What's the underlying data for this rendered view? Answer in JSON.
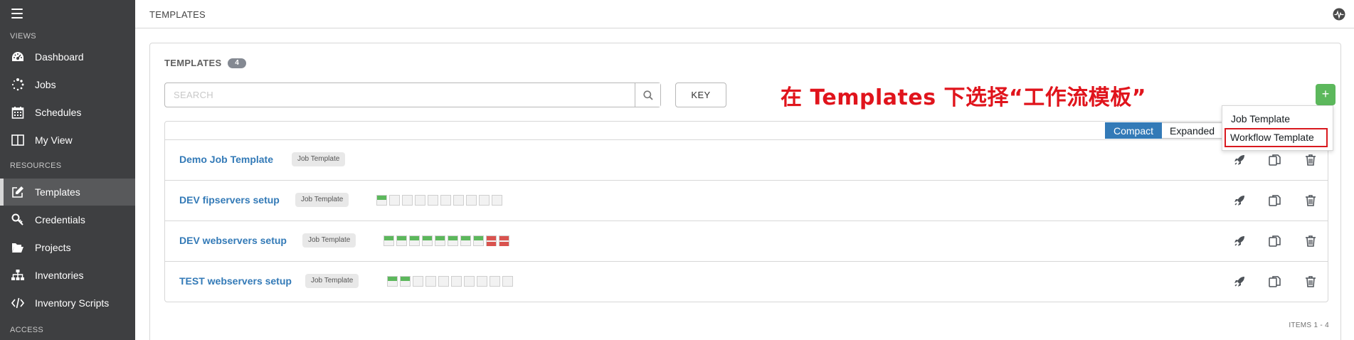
{
  "sidebar": {
    "sections": {
      "views": "VIEWS",
      "resources": "RESOURCES",
      "access": "ACCESS"
    },
    "items": [
      {
        "label": "Dashboard",
        "icon": "dashboard-icon",
        "active": false
      },
      {
        "label": "Jobs",
        "icon": "spinner-icon",
        "active": false
      },
      {
        "label": "Schedules",
        "icon": "calendar-icon",
        "active": false
      },
      {
        "label": "My View",
        "icon": "columns-icon",
        "active": false
      },
      {
        "label": "Templates",
        "icon": "pencil-square-icon",
        "active": true
      },
      {
        "label": "Credentials",
        "icon": "key-icon",
        "active": false
      },
      {
        "label": "Projects",
        "icon": "folder-open-icon",
        "active": false
      },
      {
        "label": "Inventories",
        "icon": "sitemap-icon",
        "active": false
      },
      {
        "label": "Inventory Scripts",
        "icon": "code-icon",
        "active": false
      }
    ]
  },
  "header": {
    "breadcrumb": "TEMPLATES",
    "activity_icon": "activity-stream-icon"
  },
  "panel": {
    "title": "TEMPLATES",
    "count": "4",
    "search_placeholder": "SEARCH",
    "key_label": "KEY",
    "add_label": "+",
    "annotation": "在 Templates 下选择“工作流模板”"
  },
  "view_toggle": {
    "compact": "Compact",
    "expanded": "Expanded",
    "selected": "Compact"
  },
  "dropdown": {
    "items": [
      "Job Template",
      "Workflow Template"
    ],
    "highlighted": "Workflow Template"
  },
  "templates": [
    {
      "name": "Demo Job Template",
      "type": "Job Template",
      "jobs": []
    },
    {
      "name": "DEV fipservers setup",
      "type": "Job Template",
      "jobs": [
        "ok",
        "none",
        "none",
        "none",
        "none",
        "none",
        "none",
        "none",
        "none",
        "none"
      ]
    },
    {
      "name": "DEV webservers setup",
      "type": "Job Template",
      "jobs": [
        "ok",
        "ok",
        "ok",
        "ok",
        "ok",
        "ok",
        "ok",
        "ok",
        "fail",
        "fail"
      ]
    },
    {
      "name": "TEST webservers setup",
      "type": "Job Template",
      "jobs": [
        "ok",
        "ok",
        "none",
        "none",
        "none",
        "none",
        "none",
        "none",
        "none",
        "none"
      ]
    }
  ],
  "row_actions": [
    "launch-icon",
    "copy-icon",
    "delete-icon"
  ],
  "footer": {
    "items_range": "ITEMS  1 - 4"
  },
  "colors": {
    "sidebar_bg": "#3e3f41",
    "link_blue": "#337ab7",
    "success_green": "#5cb85c",
    "fail_red": "#d9534f",
    "annotation_red": "#e0141c"
  }
}
